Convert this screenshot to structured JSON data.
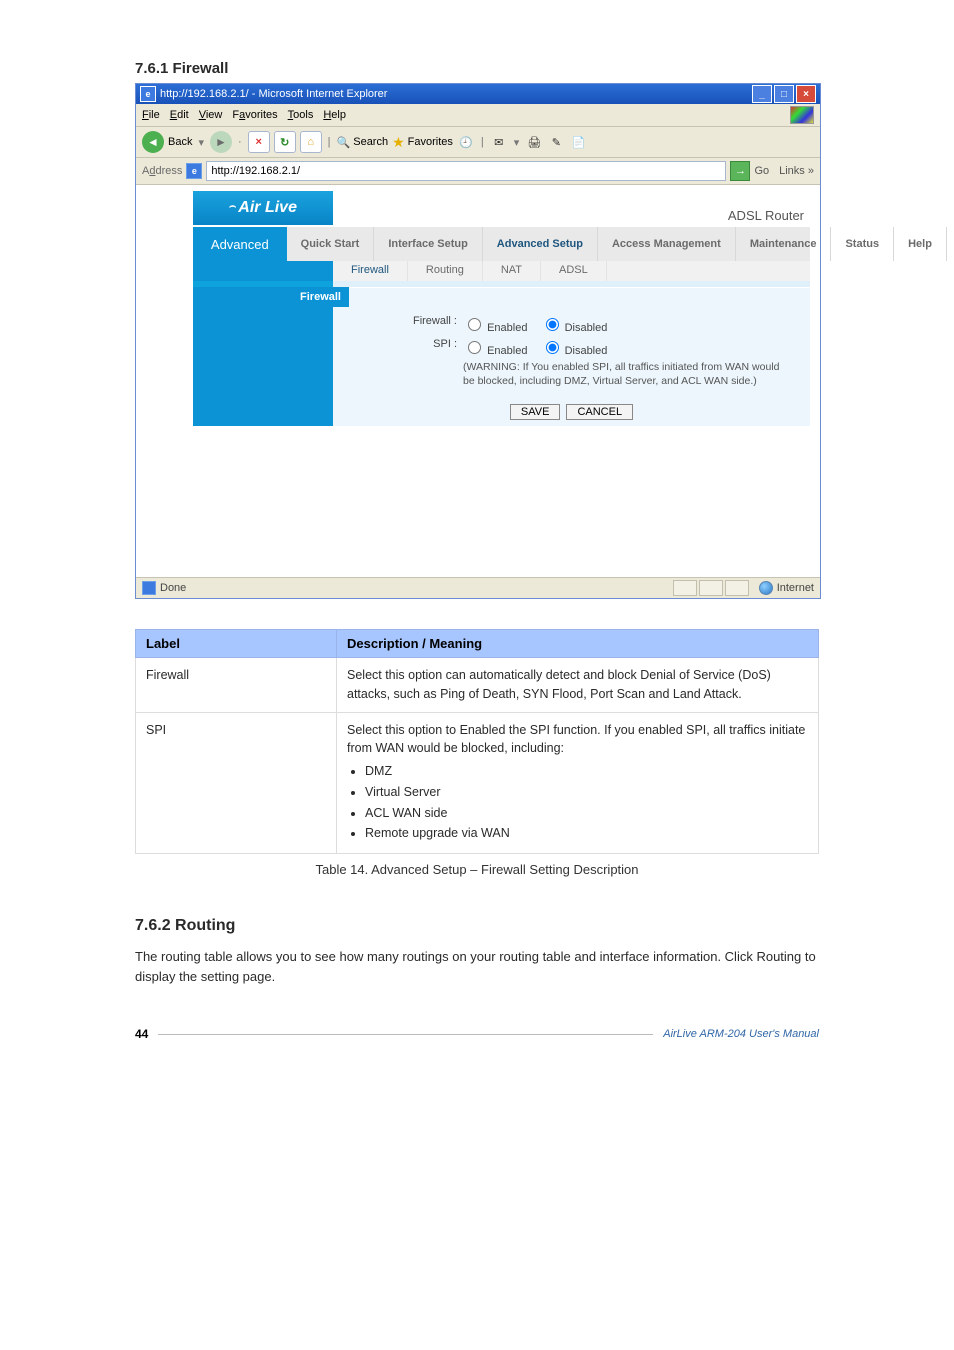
{
  "doc": {
    "section_title": "7.6.1 Firewall",
    "footer_page": "44",
    "footer_product_a": "AirLive ARM-204 ",
    "footer_product_b": "User's Manual",
    "next_heading": "7.6.2 Routing",
    "next_para": "The routing table allows you to see how many routings on your routing table and interface information. Click Routing to display the setting page."
  },
  "ie": {
    "title": "http://192.168.2.1/ - Microsoft Internet Explorer",
    "menu": [
      "File",
      "Edit",
      "View",
      "Favorites",
      "Tools",
      "Help"
    ],
    "toolbar": {
      "back": "Back",
      "search": "Search",
      "favorites": "Favorites"
    },
    "address_label": "Address",
    "address_value": "http://192.168.2.1/",
    "go": "Go",
    "links": "Links",
    "status_done": "Done",
    "status_zone": "Internet"
  },
  "router": {
    "brand": "Air Live",
    "model": "ADSL Router",
    "left_label": "Advanced",
    "tabs": [
      "Quick Start",
      "Interface Setup",
      "Advanced Setup",
      "Access Management",
      "Maintenance",
      "Status",
      "Help"
    ],
    "active_tab": 2,
    "subtabs": [
      "Firewall",
      "Routing",
      "NAT",
      "ADSL"
    ],
    "active_sub": 0,
    "section": "Firewall",
    "fields": {
      "firewall_label": "Firewall :",
      "spi_label": "SPI :",
      "opt_enabled": "Enabled",
      "opt_disabled": "Disabled",
      "warn": "(WARNING: If You enabled SPI, all traffics initiated from WAN would be blocked, including DMZ, Virtual Server, and ACL WAN side.)"
    },
    "buttons": {
      "save": "SAVE",
      "cancel": "CANCEL"
    }
  },
  "table": {
    "h_label": "Label",
    "h_meaning": "Description / Meaning",
    "rows": [
      {
        "label": "Firewall",
        "text": "Select this option can automatically detect and block Denial of Service (DoS) attacks, such as Ping of Death, SYN Flood, Port Scan and Land Attack."
      },
      {
        "label": "SPI",
        "text": "Select this option to Enabled the SPI function. If you enabled SPI, all traffics initiate from WAN would be blocked, including:",
        "items": [
          "DMZ",
          "Virtual Server",
          "ACL WAN side",
          "Remote upgrade via WAN"
        ]
      }
    ],
    "caption": "Table 14. Advanced Setup – Firewall Setting Description"
  }
}
